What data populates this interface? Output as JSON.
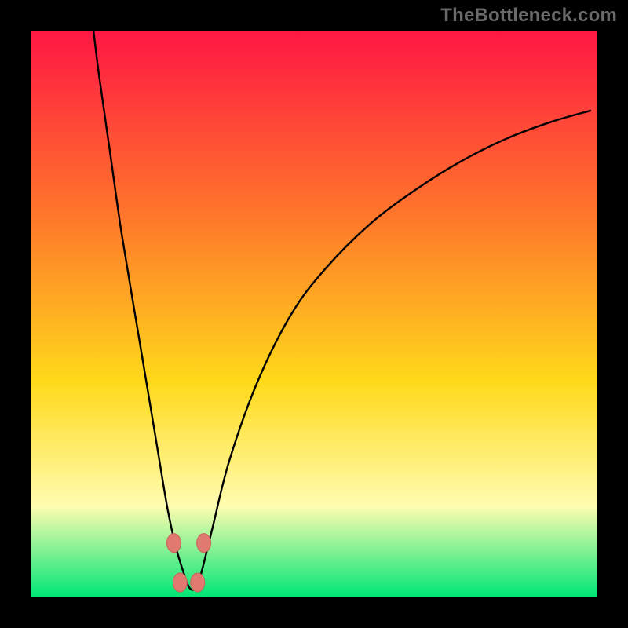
{
  "watermark": "TheBottleneck.com",
  "colors": {
    "frame": "#000000",
    "grad_top": "#ff1744",
    "grad_mid1": "#ff7b2a",
    "grad_mid2": "#ffd91a",
    "grad_mid3": "#fffcb0",
    "grad_bottom": "#00e676",
    "curve": "#000000",
    "marker_fill": "#e07a70",
    "marker_stroke": "#c86357"
  },
  "chart_data": {
    "type": "line",
    "title": "",
    "xlabel": "",
    "ylabel": "",
    "xlim": [
      0,
      100
    ],
    "ylim": [
      0,
      100
    ],
    "series": [
      {
        "name": "curve",
        "x": [
          11,
          12,
          14,
          16,
          19,
          22,
          24,
          25.5,
          27,
          28,
          29,
          30,
          32,
          35,
          40,
          46,
          52,
          60,
          68,
          76,
          84,
          92,
          99
        ],
        "y": [
          100,
          92,
          78,
          64,
          46,
          28,
          16,
          9,
          4,
          1.5,
          1.5,
          4,
          12,
          24,
          38,
          50,
          58,
          66,
          72,
          77,
          81,
          84,
          86
        ]
      }
    ],
    "markers": [
      {
        "x": 25.2,
        "y": 9.5
      },
      {
        "x": 30.5,
        "y": 9.5
      },
      {
        "x": 26.3,
        "y": 2.5
      },
      {
        "x": 29.4,
        "y": 2.5
      }
    ],
    "min_x": 27.8
  }
}
